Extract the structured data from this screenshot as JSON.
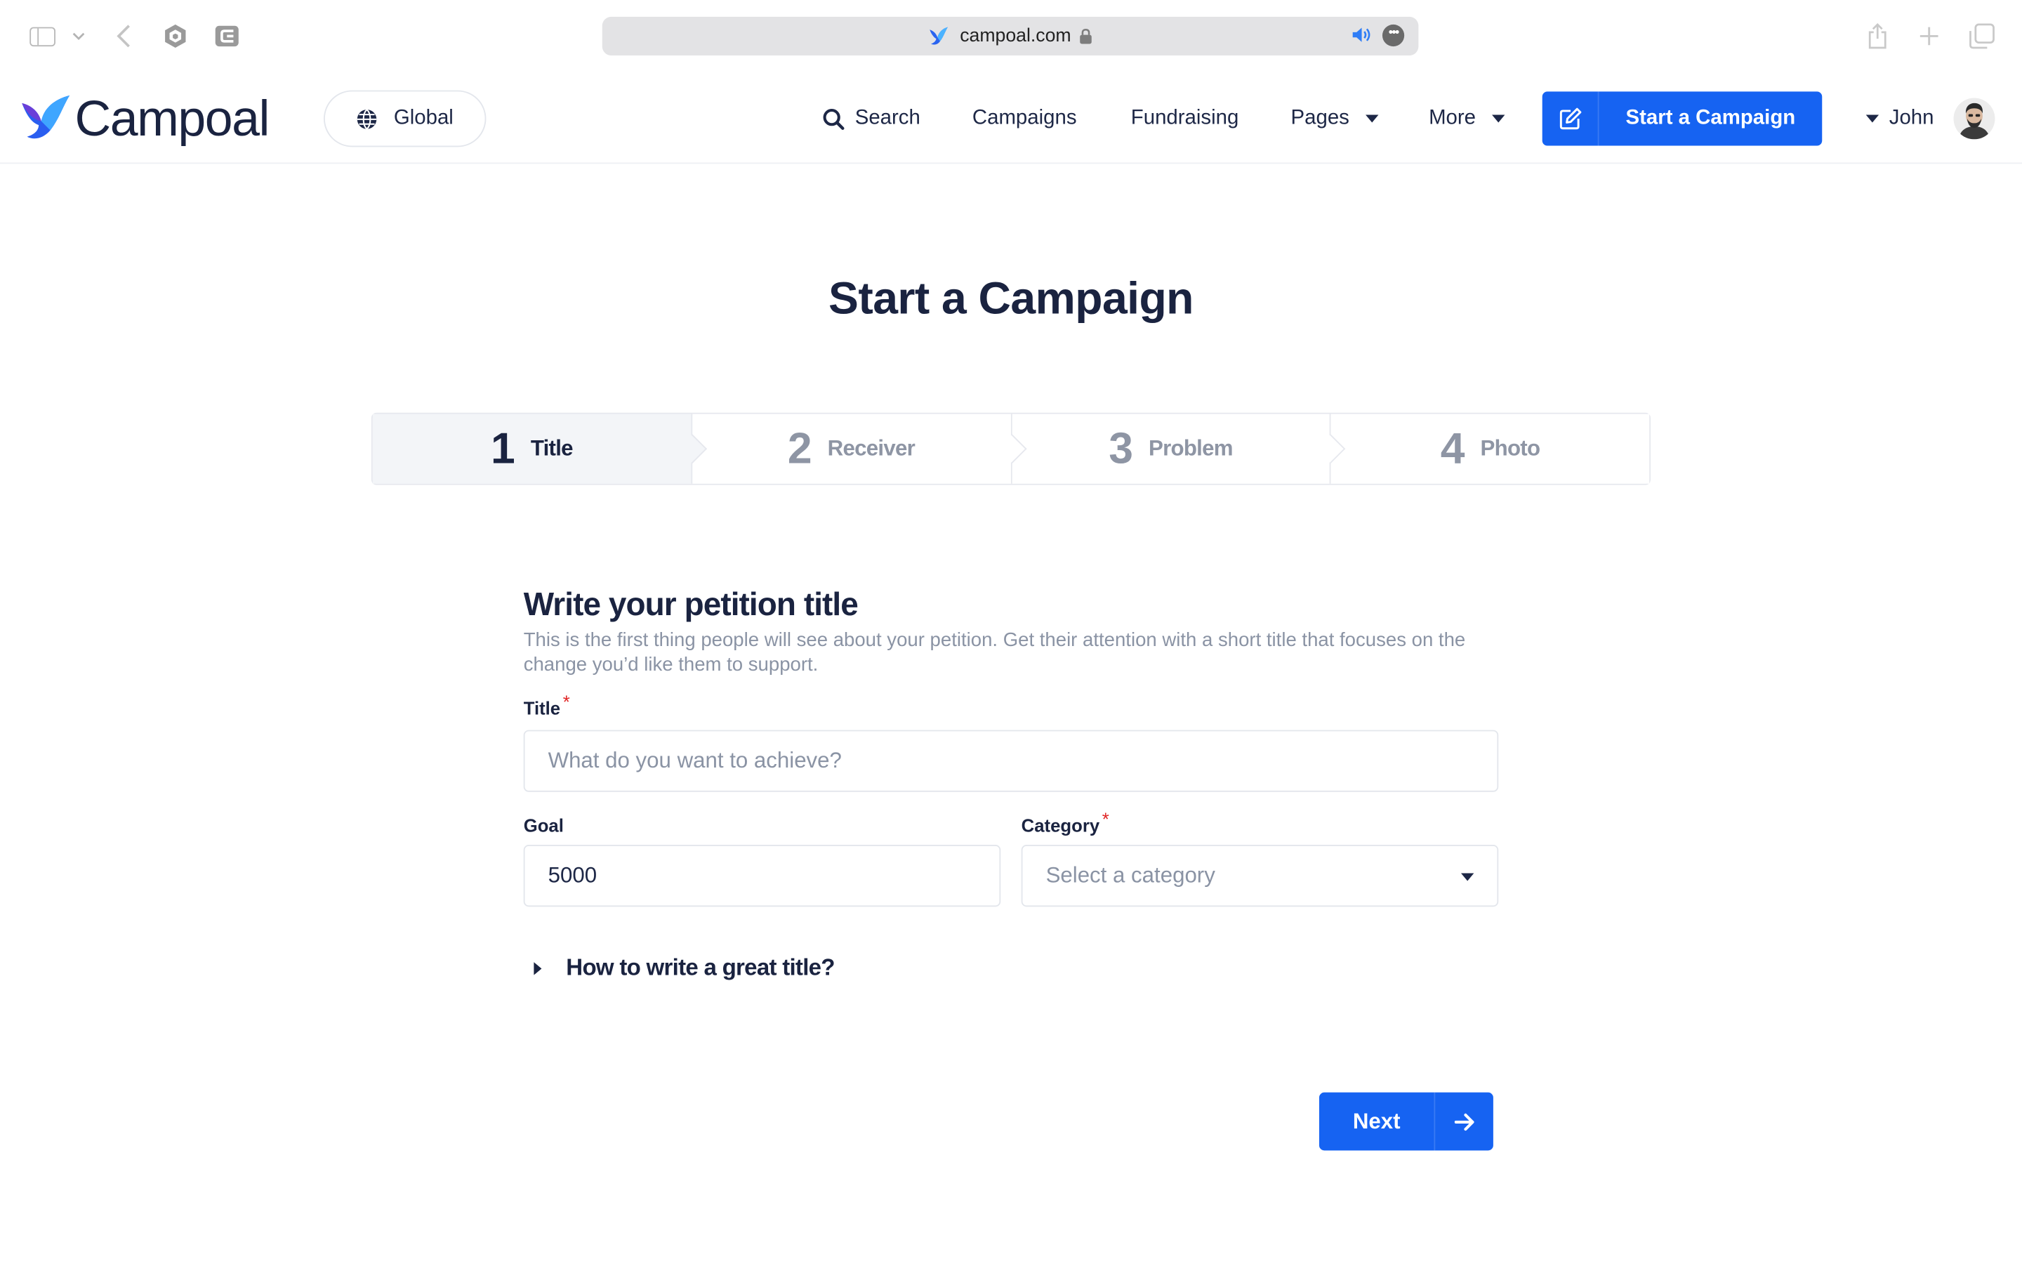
{
  "browser": {
    "url": "campoal.com"
  },
  "header": {
    "logo_text": "Campoal",
    "global_label": "Global",
    "nav": {
      "search": "Search",
      "campaigns": "Campaigns",
      "fundraising": "Fundraising",
      "pages": "Pages",
      "more": "More"
    },
    "start_campaign_label": "Start a Campaign",
    "user_name": "John"
  },
  "main": {
    "page_title": "Start a Campaign",
    "steps": [
      {
        "number": "1",
        "label": "Title",
        "active": true
      },
      {
        "number": "2",
        "label": "Receiver",
        "active": false
      },
      {
        "number": "3",
        "label": "Problem",
        "active": false
      },
      {
        "number": "4",
        "label": "Photo",
        "active": false
      }
    ],
    "form": {
      "heading": "Write your petition title",
      "description": "This is the first thing people will see about your petition. Get their attention with a short title that focuses on the change you’d like them to support.",
      "title_label": "Title",
      "title_placeholder": "What do you want to achieve?",
      "goal_label": "Goal",
      "goal_value": "5000",
      "category_label": "Category",
      "category_placeholder": "Select a category",
      "required_mark": "*",
      "howto_label": "How to write a great title?"
    },
    "next_label": "Next"
  },
  "colors": {
    "primary": "#1663f2",
    "text_dark": "#1a2340",
    "text_muted": "#8a93a4",
    "required": "#e02424"
  }
}
